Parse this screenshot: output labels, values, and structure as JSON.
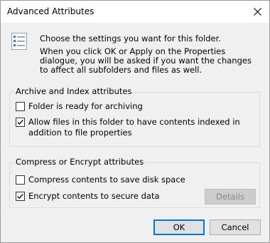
{
  "window": {
    "title": "Advanced Attributes",
    "close_icon": "close-icon"
  },
  "intro": {
    "icon": "attributes-list-icon",
    "line1": "Choose the settings you want for this folder.",
    "line2": "When you click OK or Apply on the Properties dialogue, you will be asked if you want the changes to affect all subfolders and files as well."
  },
  "archive_group": {
    "title": "Archive and Index attributes",
    "options": [
      {
        "label": "Folder is ready for archiving",
        "checked": false
      },
      {
        "label": "Allow files in this folder to have contents indexed in addition to file properties",
        "checked": true
      }
    ]
  },
  "compress_group": {
    "title": "Compress or Encrypt attributes",
    "options": [
      {
        "label": "Compress contents to save disk space",
        "checked": false
      },
      {
        "label": "Encrypt contents to secure data",
        "checked": true
      }
    ],
    "details_label": "Details"
  },
  "buttons": {
    "ok_label": "OK",
    "cancel_label": "Cancel"
  }
}
